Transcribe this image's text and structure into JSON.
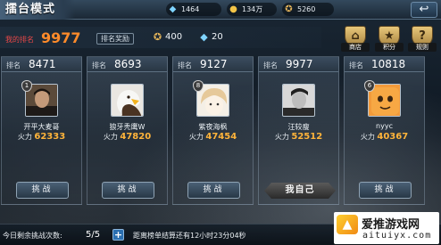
{
  "header": {
    "title": "擂台模式",
    "resources": [
      {
        "icon": "diamond-icon",
        "value": "1464"
      },
      {
        "icon": "gold-coin-icon",
        "value": "134万"
      },
      {
        "icon": "honor-medal-icon",
        "value": "5260"
      }
    ],
    "back_icon": "back-arrow-icon"
  },
  "my_info": {
    "rank_label": "我的排名",
    "rank_value": "9977",
    "reward_label": "排名奖励",
    "rewards": [
      {
        "icon": "honor-medal-icon",
        "value": "400"
      },
      {
        "icon": "diamond-icon",
        "value": "20"
      }
    ]
  },
  "side_buttons": [
    {
      "name": "shop",
      "icon": "shop-icon",
      "label": "商店"
    },
    {
      "name": "points",
      "icon": "points-icon",
      "label": "积分"
    },
    {
      "name": "rules",
      "icon": "question-icon",
      "label": "规则"
    }
  ],
  "cards": [
    {
      "rank_label": "排名",
      "rank": "8471",
      "level": "1",
      "name": "开平大麦哥",
      "power_label": "火力",
      "power": "62333",
      "action": "挑战",
      "avatar": "man-portrait"
    },
    {
      "rank_label": "排名",
      "rank": "8693",
      "level": "",
      "name": "狼牙秃鹰W",
      "power_label": "火力",
      "power": "47820",
      "action": "挑战",
      "avatar": "eagle"
    },
    {
      "rank_label": "排名",
      "rank": "9127",
      "level": "8",
      "name": "紫夜海枫",
      "power_label": "火力",
      "power": "47454",
      "action": "挑战",
      "avatar": "anime-character"
    },
    {
      "rank_label": "排名",
      "rank": "9977",
      "level": "",
      "name": "汪较瘦",
      "power_label": "火力",
      "power": "52512",
      "action": "我自己",
      "avatar": "man-bw-portrait"
    },
    {
      "rank_label": "排名",
      "rank": "10818",
      "level": "6",
      "name": "nyyc",
      "power_label": "火力",
      "power": "40367",
      "action": "挑战",
      "avatar": "orange-cartoon"
    }
  ],
  "bottom": {
    "remaining_label": "今日剩余挑战次数:",
    "remaining_value": "5/5",
    "plus": "+",
    "countdown": "距离榜单结算还有12小时23分04秒"
  },
  "watermark": {
    "name": "爱推游戏网",
    "url": "aituiyx.com"
  },
  "colors": {
    "rank_label": "#e94848",
    "rank_value": "#ff8b2a",
    "power_value": "#ffb43a"
  }
}
